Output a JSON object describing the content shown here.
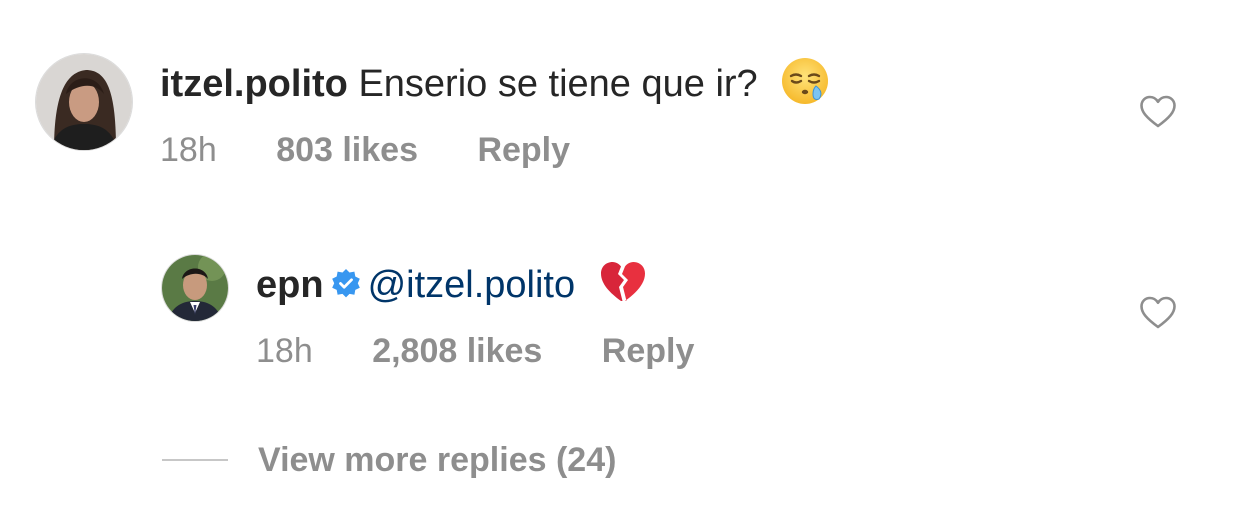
{
  "comments": [
    {
      "username": "itzel.polito",
      "text": "Enserio se tiene que ir?",
      "emoji": "sleepy-face",
      "time": "18h",
      "likes": "803 likes",
      "reply_label": "Reply"
    },
    {
      "username": "epn",
      "verified": true,
      "mention": "@itzel.polito",
      "emoji": "broken-heart",
      "time": "18h",
      "likes": "2,808 likes",
      "reply_label": "Reply"
    }
  ],
  "view_more_replies": "View more replies (24)",
  "colors": {
    "text": "#262626",
    "muted": "#8e8e8e",
    "mention": "#003569",
    "verified": "#3897f0"
  }
}
